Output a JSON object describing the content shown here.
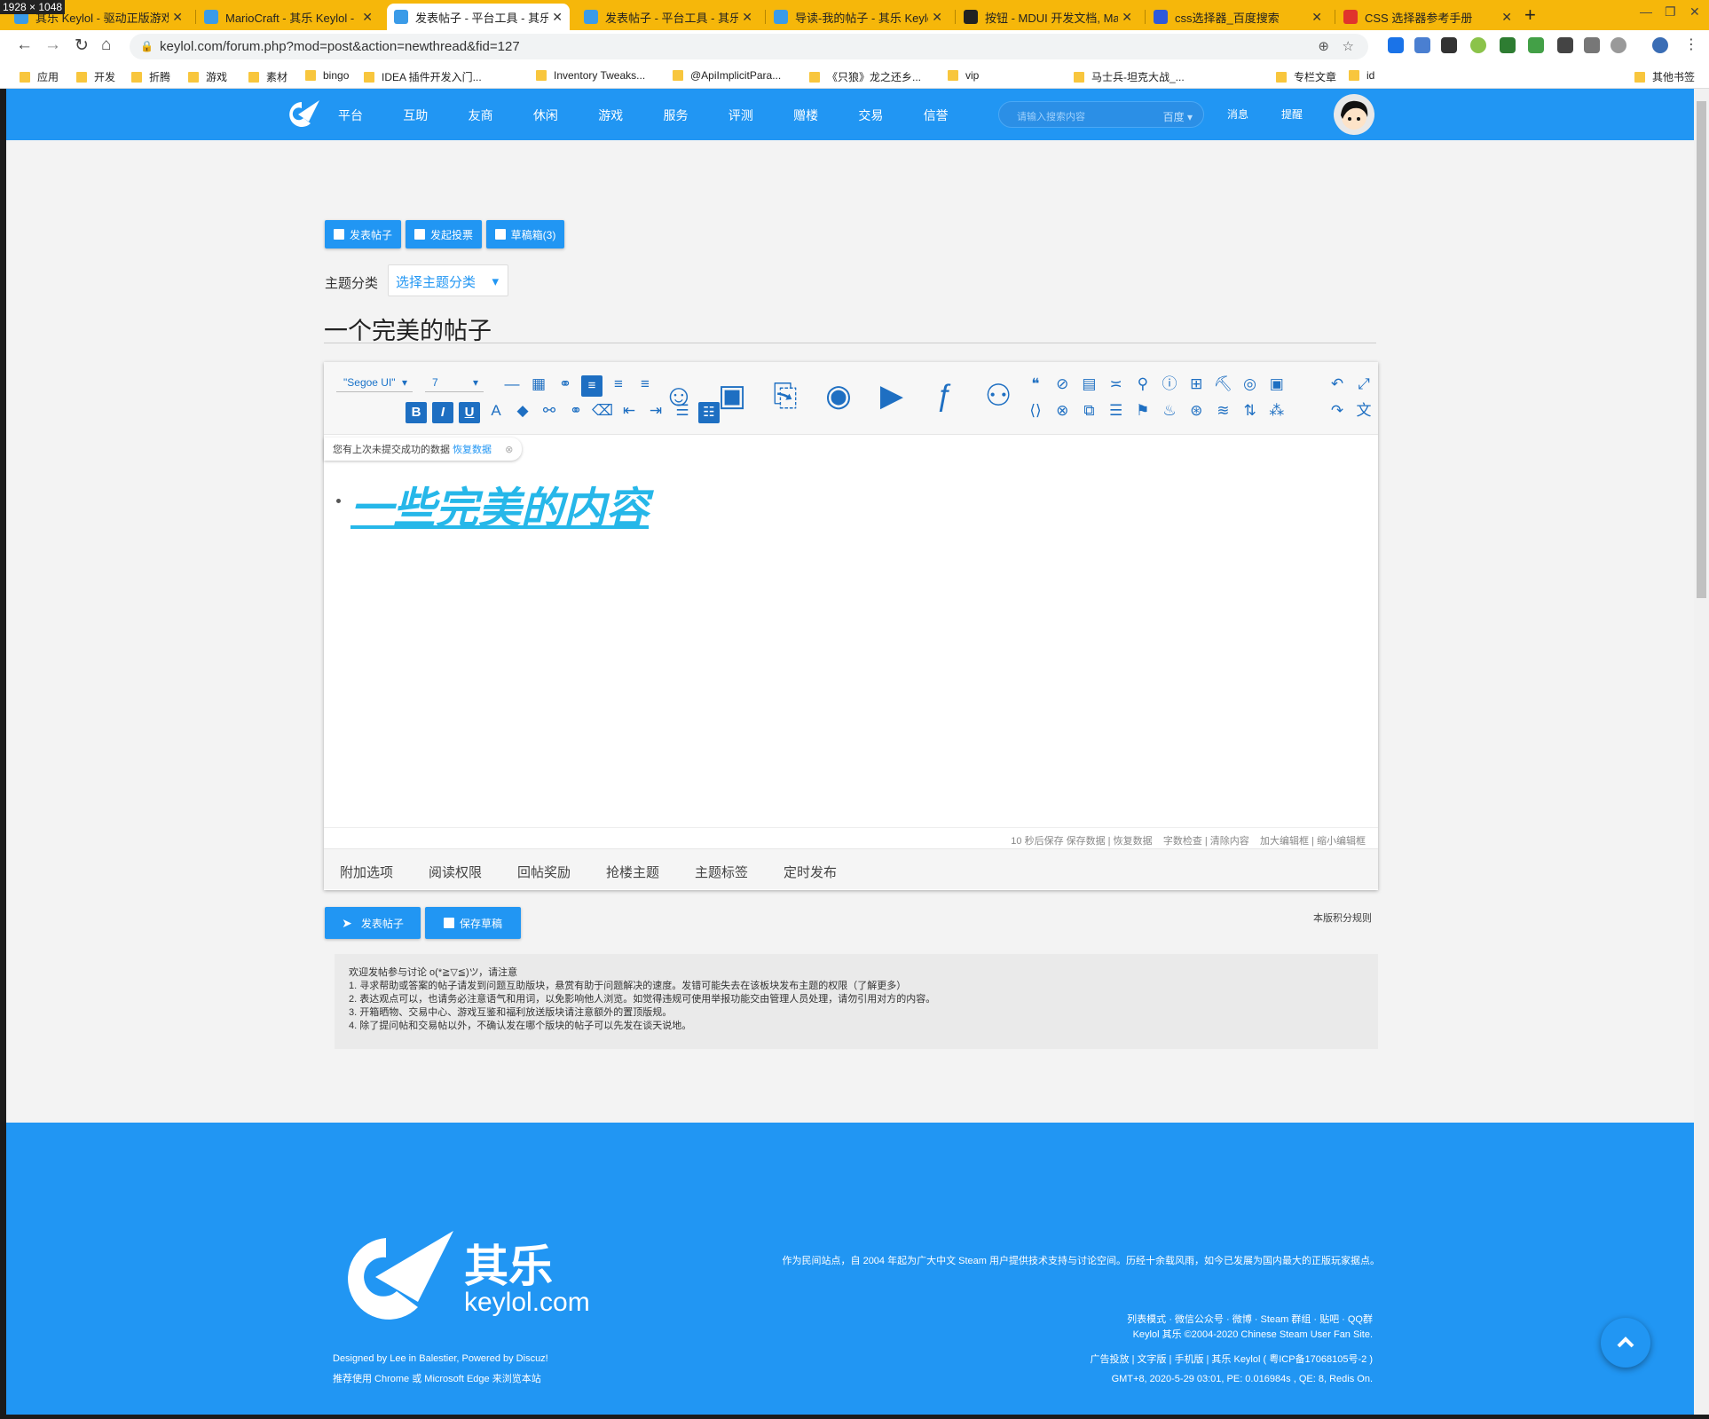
{
  "overlay": {
    "dims": "1928 × 1048"
  },
  "browser": {
    "tabs": [
      {
        "title": "其乐 Keylol - 驱动正版游戏",
        "active": false,
        "color": "#3a9be8"
      },
      {
        "title": "MarioCraft - 其乐 Keylol -",
        "active": false,
        "color": "#3a9be8"
      },
      {
        "title": "发表帖子 - 平台工具 - 其乐",
        "active": true,
        "color": "#3a9be8"
      },
      {
        "title": "发表帖子 - 平台工具 - 其乐",
        "active": false,
        "color": "#3a9be8"
      },
      {
        "title": "导读-我的帖子 - 其乐 Keylo",
        "active": false,
        "color": "#3a9be8"
      },
      {
        "title": "按钮 - MDUI 开发文档, Ma",
        "active": false,
        "color": "#222"
      },
      {
        "title": "css选择器_百度搜索",
        "active": false,
        "color": "#2e59d9"
      },
      {
        "title": "CSS 选择器参考手册",
        "active": false,
        "color": "#e0342c"
      }
    ],
    "url": "keylol.com/forum.php?mod=post&action=newthread&fid=127",
    "bookmarks": [
      "应用",
      "开发",
      "折腾",
      "游戏",
      "素材",
      "bingo",
      "IDEA 插件开发入门...",
      "Inventory Tweaks...",
      "@ApiImplicitPara...",
      "《只狼》龙之还乡...",
      "vip",
      "马士兵-坦克大战_...",
      "专栏文章",
      "id",
      "其他书签"
    ]
  },
  "site": {
    "nav": [
      "平台",
      "互助",
      "友商",
      "休闲",
      "游戏",
      "服务",
      "评测",
      "赠楼",
      "交易",
      "信誉"
    ],
    "search_placeholder": "请输入搜索内容",
    "search_engine": "百度",
    "messages": "消息",
    "alerts": "提醒"
  },
  "post": {
    "actions": [
      "发表帖子",
      "发起投票",
      "草稿箱(3)"
    ],
    "category_label": "主题分类",
    "category_select": "选择主题分类",
    "title": "一个完美的帖子",
    "font_family": "\"Segoe UI\"",
    "font_size": "7",
    "restore_notice": "您有上次未提交成功的数据",
    "restore_link": "恢复数据",
    "content": "一些完美的内容",
    "status_bar": "10 秒后保存 保存数据 | 恢复数据    字数检查 | 清除内容    加大编辑框 | 缩小编辑框",
    "tabs": [
      "附加选项",
      "阅读权限",
      "回帖奖励",
      "抢楼主题",
      "主题标签",
      "定时发布"
    ],
    "submit": "发表帖子",
    "save_draft": "保存草稿",
    "rules_link": "本版积分规则"
  },
  "rules": {
    "intro": "欢迎发帖参与讨论 o(*≧▽≦)ツ，请注意",
    "line1": "1. 寻求帮助或答案的帖子请发到问题互助版块，悬赏有助于问题解决的速度。发错可能失去在该板块发布主题的权限（了解更多）",
    "line2": "2. 表达观点可以，也请务必注意语气和用词，以免影响他人浏览。如觉得违规可使用举报功能交由管理人员处理，请勿引用对方的内容。",
    "line3": "3. 开箱晒物、交易中心、游戏互鉴和福利放送版块请注意额外的置顶版规。",
    "line4": "4. 除了提问帖和交易帖以外，不确认发在哪个版块的帖子可以先发在谈天说地。"
  },
  "footer": {
    "brand_cn": "其乐",
    "brand_en": "keylol.com",
    "about": "作为民间站点，自 2004 年起为广大中文 Steam 用户提供技术支持与讨论空间。历经十余载风雨，如今已发展为国内最大的正版玩家据点。",
    "links": "列表模式 · 微信公众号 · 微博 · Steam 群组 · 贴吧 · QQ群",
    "copyright": "Keylol 其乐 ©2004-2020 Chinese Steam User Fan Site.",
    "legal": "广告投放 | 文字版 | 手机版 | 其乐 Keylol ( 粤ICP备17068105号-2 )",
    "stats": "GMT+8, 2020-5-29 03:01, PE: 0.016984s , QE: 8, Redis On.",
    "credit": "Designed by Lee in Balestier, Powered by Discuz!",
    "recommend": "推荐使用 Chrome 或 Microsoft Edge 来浏览本站"
  }
}
